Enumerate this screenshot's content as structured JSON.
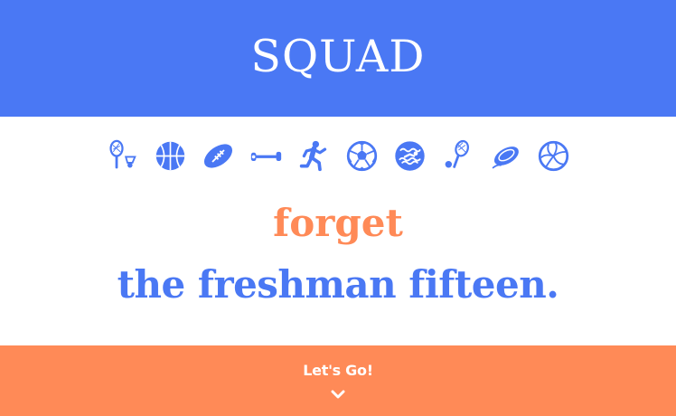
{
  "header": {
    "brand": "SQUAD"
  },
  "sports_icons": [
    "badminton-icon",
    "basketball-icon",
    "football-icon",
    "dumbbell-icon",
    "runner-icon",
    "soccer-ball-icon",
    "swimming-icon",
    "tennis-icon",
    "frisbee-icon",
    "volleyball-icon"
  ],
  "tagline": {
    "line1": "forget",
    "line2": "the freshman fifteen."
  },
  "cta": {
    "label": "Let's Go!",
    "icon": "chevron-down-icon"
  },
  "colors": {
    "blue": "#4a78f4",
    "orange": "#ff8a57",
    "white": "#ffffff"
  }
}
